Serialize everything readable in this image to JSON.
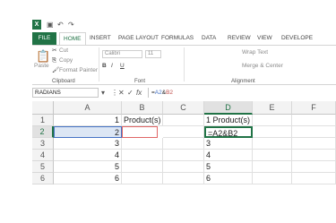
{
  "qat": {
    "undo": "↶",
    "redo": "↷"
  },
  "tabs": {
    "file": "FILE",
    "home": "HOME",
    "insert": "INSERT",
    "page_layout": "PAGE LAYOUT",
    "formulas": "FORMULAS",
    "data": "DATA",
    "review": "REVIEW",
    "view": "VIEW",
    "developer": "DEVELOPE"
  },
  "ribbon": {
    "paste": "Paste",
    "cut": "Cut",
    "copy": "Copy",
    "format_painter": "Format Painter",
    "clipboard_label": "Clipboard",
    "font_name": "Calibri",
    "font_size": "11",
    "bold": "B",
    "italic": "I",
    "underline": "U",
    "font_label": "Font",
    "wrap_text": "Wrap Text",
    "merge_center": "Merge & Center",
    "alignment_label": "Alignment"
  },
  "formula_bar": {
    "name_box": "RADIANS",
    "cancel": "✕",
    "enter": "✓",
    "fx": "fx",
    "formula": "=A2&B2"
  },
  "columns": [
    "A",
    "B",
    "C",
    "D",
    "E",
    "F"
  ],
  "rows": [
    {
      "num": "1",
      "A": "1",
      "B": "Product(s)",
      "D": "1 Product(s)"
    },
    {
      "num": "2",
      "A": "2",
      "B": "",
      "D": "=A2&B2"
    },
    {
      "num": "3",
      "A": "3",
      "B": "",
      "D": "3"
    },
    {
      "num": "4",
      "A": "4",
      "B": "",
      "D": "4"
    },
    {
      "num": "5",
      "A": "5",
      "B": "",
      "D": "5"
    },
    {
      "num": "6",
      "A": "6",
      "B": "",
      "D": "6"
    }
  ],
  "colors": {
    "excel_green": "#217346",
    "ref_blue": "#4472c4",
    "ref_red": "#e06666"
  }
}
